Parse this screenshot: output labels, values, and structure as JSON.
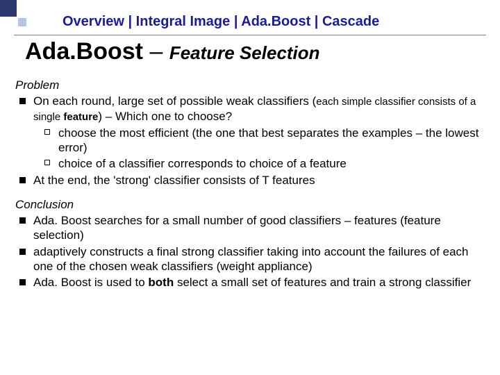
{
  "breadcrumb": {
    "items": [
      "Overview",
      "Integral Image",
      "Ada.Boost",
      "Cascade"
    ],
    "sep": " | "
  },
  "title": {
    "main": "Ada.Boost",
    "dash": " – ",
    "sub": "Feature Selection"
  },
  "problem": {
    "label": "Problem",
    "b1_pre": "On each round, large set of possible weak classifiers (",
    "b1_small": "each simple classifier consists of a single ",
    "b1_small_bold": "feature",
    "b1_post": ") – Which one to choose?",
    "s1": "choose the most efficient (the one that best separates the examples – the lowest error)",
    "s2": "choice of a classifier corresponds to choice of a feature",
    "b2": "At the end, the 'strong' classifier consists of T features"
  },
  "conclusion": {
    "label": "Conclusion",
    "b1": "Ada. Boost searches for a small number of good classifiers – features (feature selection)",
    "b2": "adaptively constructs a final strong classifier taking into account the failures of each one of the chosen weak classifiers (weight appliance)",
    "b3_pre": "Ada. Boost is used to ",
    "b3_bold": "both",
    "b3_post": " select a small set of features and train a strong classifier"
  }
}
